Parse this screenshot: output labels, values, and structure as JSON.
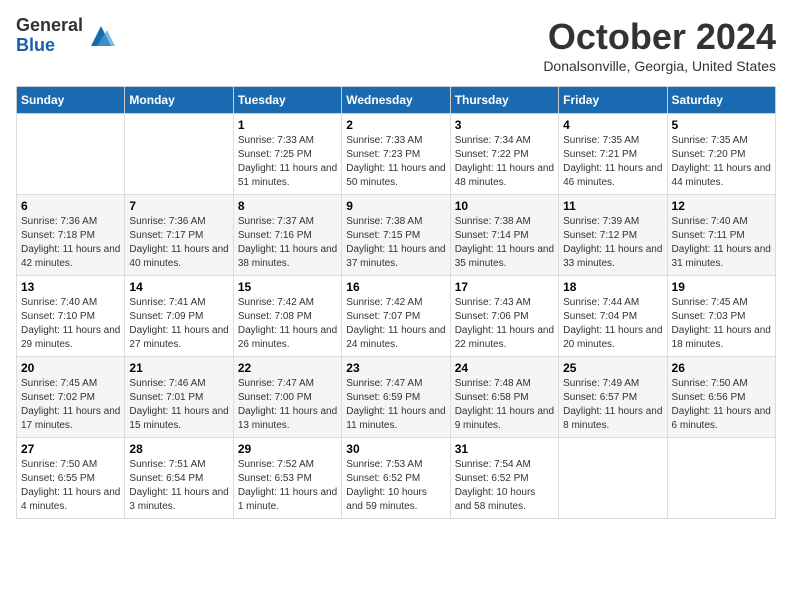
{
  "logo": {
    "general": "General",
    "blue": "Blue"
  },
  "title": "October 2024",
  "location": "Donalsonville, Georgia, United States",
  "days_header": [
    "Sunday",
    "Monday",
    "Tuesday",
    "Wednesday",
    "Thursday",
    "Friday",
    "Saturday"
  ],
  "weeks": [
    [
      {
        "day": "",
        "info": ""
      },
      {
        "day": "",
        "info": ""
      },
      {
        "day": "1",
        "info": "Sunrise: 7:33 AM\nSunset: 7:25 PM\nDaylight: 11 hours and 51 minutes."
      },
      {
        "day": "2",
        "info": "Sunrise: 7:33 AM\nSunset: 7:23 PM\nDaylight: 11 hours and 50 minutes."
      },
      {
        "day": "3",
        "info": "Sunrise: 7:34 AM\nSunset: 7:22 PM\nDaylight: 11 hours and 48 minutes."
      },
      {
        "day": "4",
        "info": "Sunrise: 7:35 AM\nSunset: 7:21 PM\nDaylight: 11 hours and 46 minutes."
      },
      {
        "day": "5",
        "info": "Sunrise: 7:35 AM\nSunset: 7:20 PM\nDaylight: 11 hours and 44 minutes."
      }
    ],
    [
      {
        "day": "6",
        "info": "Sunrise: 7:36 AM\nSunset: 7:18 PM\nDaylight: 11 hours and 42 minutes."
      },
      {
        "day": "7",
        "info": "Sunrise: 7:36 AM\nSunset: 7:17 PM\nDaylight: 11 hours and 40 minutes."
      },
      {
        "day": "8",
        "info": "Sunrise: 7:37 AM\nSunset: 7:16 PM\nDaylight: 11 hours and 38 minutes."
      },
      {
        "day": "9",
        "info": "Sunrise: 7:38 AM\nSunset: 7:15 PM\nDaylight: 11 hours and 37 minutes."
      },
      {
        "day": "10",
        "info": "Sunrise: 7:38 AM\nSunset: 7:14 PM\nDaylight: 11 hours and 35 minutes."
      },
      {
        "day": "11",
        "info": "Sunrise: 7:39 AM\nSunset: 7:12 PM\nDaylight: 11 hours and 33 minutes."
      },
      {
        "day": "12",
        "info": "Sunrise: 7:40 AM\nSunset: 7:11 PM\nDaylight: 11 hours and 31 minutes."
      }
    ],
    [
      {
        "day": "13",
        "info": "Sunrise: 7:40 AM\nSunset: 7:10 PM\nDaylight: 11 hours and 29 minutes."
      },
      {
        "day": "14",
        "info": "Sunrise: 7:41 AM\nSunset: 7:09 PM\nDaylight: 11 hours and 27 minutes."
      },
      {
        "day": "15",
        "info": "Sunrise: 7:42 AM\nSunset: 7:08 PM\nDaylight: 11 hours and 26 minutes."
      },
      {
        "day": "16",
        "info": "Sunrise: 7:42 AM\nSunset: 7:07 PM\nDaylight: 11 hours and 24 minutes."
      },
      {
        "day": "17",
        "info": "Sunrise: 7:43 AM\nSunset: 7:06 PM\nDaylight: 11 hours and 22 minutes."
      },
      {
        "day": "18",
        "info": "Sunrise: 7:44 AM\nSunset: 7:04 PM\nDaylight: 11 hours and 20 minutes."
      },
      {
        "day": "19",
        "info": "Sunrise: 7:45 AM\nSunset: 7:03 PM\nDaylight: 11 hours and 18 minutes."
      }
    ],
    [
      {
        "day": "20",
        "info": "Sunrise: 7:45 AM\nSunset: 7:02 PM\nDaylight: 11 hours and 17 minutes."
      },
      {
        "day": "21",
        "info": "Sunrise: 7:46 AM\nSunset: 7:01 PM\nDaylight: 11 hours and 15 minutes."
      },
      {
        "day": "22",
        "info": "Sunrise: 7:47 AM\nSunset: 7:00 PM\nDaylight: 11 hours and 13 minutes."
      },
      {
        "day": "23",
        "info": "Sunrise: 7:47 AM\nSunset: 6:59 PM\nDaylight: 11 hours and 11 minutes."
      },
      {
        "day": "24",
        "info": "Sunrise: 7:48 AM\nSunset: 6:58 PM\nDaylight: 11 hours and 9 minutes."
      },
      {
        "day": "25",
        "info": "Sunrise: 7:49 AM\nSunset: 6:57 PM\nDaylight: 11 hours and 8 minutes."
      },
      {
        "day": "26",
        "info": "Sunrise: 7:50 AM\nSunset: 6:56 PM\nDaylight: 11 hours and 6 minutes."
      }
    ],
    [
      {
        "day": "27",
        "info": "Sunrise: 7:50 AM\nSunset: 6:55 PM\nDaylight: 11 hours and 4 minutes."
      },
      {
        "day": "28",
        "info": "Sunrise: 7:51 AM\nSunset: 6:54 PM\nDaylight: 11 hours and 3 minutes."
      },
      {
        "day": "29",
        "info": "Sunrise: 7:52 AM\nSunset: 6:53 PM\nDaylight: 11 hours and 1 minute."
      },
      {
        "day": "30",
        "info": "Sunrise: 7:53 AM\nSunset: 6:52 PM\nDaylight: 10 hours and 59 minutes."
      },
      {
        "day": "31",
        "info": "Sunrise: 7:54 AM\nSunset: 6:52 PM\nDaylight: 10 hours and 58 minutes."
      },
      {
        "day": "",
        "info": ""
      },
      {
        "day": "",
        "info": ""
      }
    ]
  ]
}
